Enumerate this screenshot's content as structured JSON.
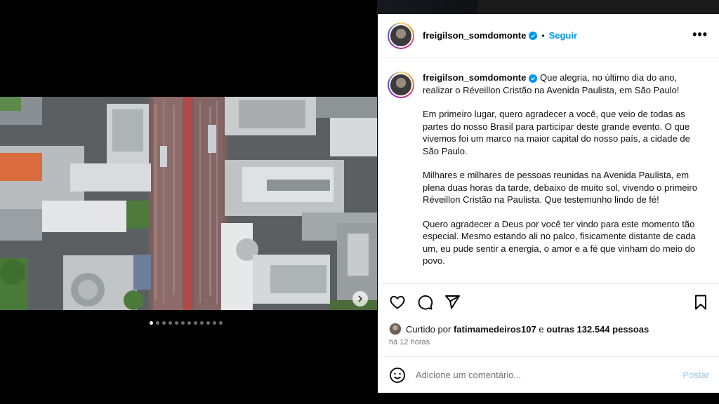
{
  "post": {
    "username": "freigilson_somdomonte",
    "separator": "•",
    "follow_label": "Seguir",
    "more_label": "•••"
  },
  "media": {
    "icon": "chevron-right-icon",
    "carousel_total": 12,
    "carousel_index": 1
  },
  "caption": {
    "username": "freigilson_somdomonte",
    "first_line": "Que alegria, no último dia do ano, realizar o Réveillon Cristão na Avenida Paulista, em São Paulo!",
    "paragraph_2": "Em primeiro lugar, quero agradecer a você, que veio de todas as partes do nosso Brasil para participar deste grande evento. O que vivemos foi um marco na maior capital do nosso país, a cidade de São Paulo.",
    "paragraph_3": "Milhares e milhares de pessoas reunidas na Avenida Paulista, em plena duas horas da tarde, debaixo de muito sol, vivendo o primeiro Réveillon Cristão na Paulista. Que testemunho lindo de fé!",
    "paragraph_4": "Quero agradecer a Deus por você ter vindo para este momento tão especial. Mesmo estando ali no palco, fisicamente distante de cada um, eu pude sentir a energia, o amor e a fé que vinham do meio do povo."
  },
  "actions": {
    "like_icon": "heart-icon",
    "comment_icon": "comment-icon",
    "share_icon": "share-icon",
    "save_icon": "bookmark-icon"
  },
  "likes": {
    "prefix": "Curtido por",
    "user": "fatimamedeiros107",
    "middle": "e",
    "others": "outras 132.544 pessoas"
  },
  "timestamp": "há 12 horas",
  "comment": {
    "placeholder": "Adicione um comentário...",
    "post_label": "Postar",
    "emoji_icon": "emoji-icon"
  },
  "colors": {
    "accent": "#0095f6",
    "post_disabled": "#9bc7f1",
    "muted": "#737373"
  }
}
